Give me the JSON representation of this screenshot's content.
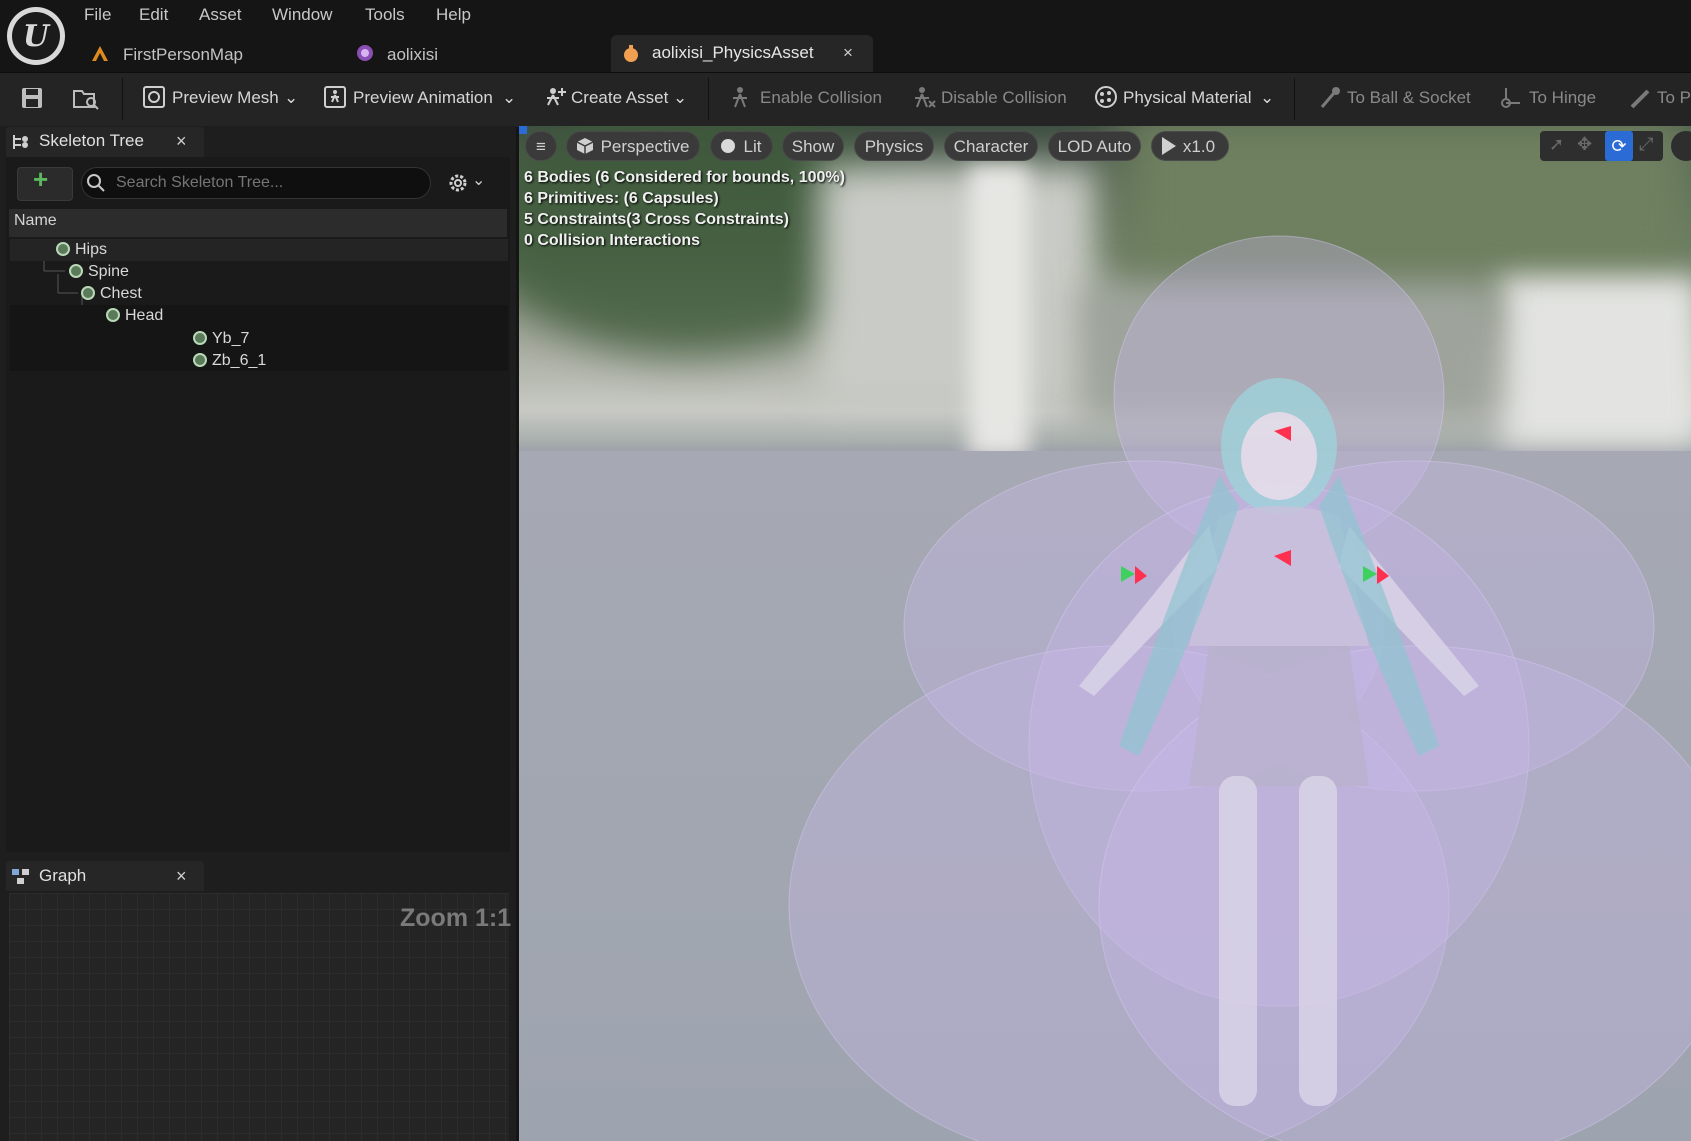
{
  "menu": [
    "File",
    "Edit",
    "Asset",
    "Window",
    "Tools",
    "Help"
  ],
  "tabs": [
    {
      "label": "FirstPersonMap",
      "icon": "level-icon"
    },
    {
      "label": "aolixisi",
      "icon": "skeletal-mesh-icon"
    },
    {
      "label": "aolixisi_PhysicsAsset",
      "icon": "physics-asset-icon",
      "active": true,
      "close": "×"
    }
  ],
  "toolbar": {
    "preview_mesh": "Preview Mesh",
    "preview_animation": "Preview Animation",
    "create_asset": "Create Asset",
    "enable_collision": "Enable Collision",
    "disable_collision": "Disable Collision",
    "physical_material": "Physical Material",
    "to_ball_socket": "To Ball & Socket",
    "to_hinge": "To Hinge",
    "to_p": "To P"
  },
  "skeleton_tree": {
    "tab_label": "Skeleton Tree",
    "close": "×",
    "add": "+",
    "search_placeholder": "Search Skeleton Tree...",
    "column_name": "Name",
    "bones": [
      "Hips",
      "Spine",
      "Chest",
      "Head",
      "Yb_7",
      "Zb_6_1"
    ]
  },
  "graph": {
    "tab_label": "Graph",
    "close": "×",
    "zoom": "Zoom 1:1"
  },
  "viewport": {
    "menu_icon": "hamburger-icon",
    "perspective": "Perspective",
    "lit": "Lit",
    "show": "Show",
    "physics": "Physics",
    "character": "Character",
    "lod": "LOD Auto",
    "speed": "x1.0",
    "stats": [
      "6 Bodies (6 Considered for bounds, 100%)",
      "6 Primitives: (6 Capsules)",
      "5 Constraints(3 Cross Constraints)",
      "0 Collision Interactions"
    ]
  },
  "colors": {
    "accent": "#2a6bd6",
    "add_green": "#5cb85c",
    "physics_body": "#b9a6e0"
  }
}
